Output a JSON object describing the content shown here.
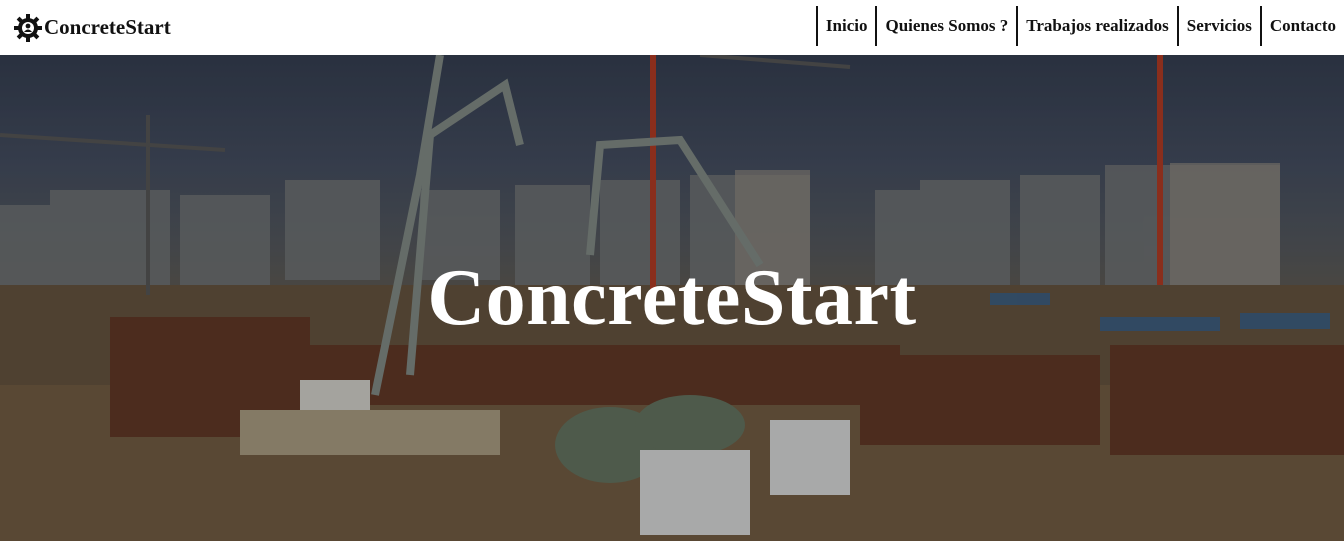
{
  "navbar": {
    "brand": "ConcreteStart",
    "brand_icon": "gear-icon",
    "links": [
      "Inicio",
      "Quienes Somos ?",
      "Trabajos realizados",
      "Servicios",
      "Contacto"
    ]
  },
  "hero": {
    "title": "ConcreteStart",
    "background_image": "construction-site-photo"
  },
  "colors": {
    "nav_bg": "#ffffff",
    "nav_text": "#111111",
    "hero_text": "#ffffff"
  }
}
